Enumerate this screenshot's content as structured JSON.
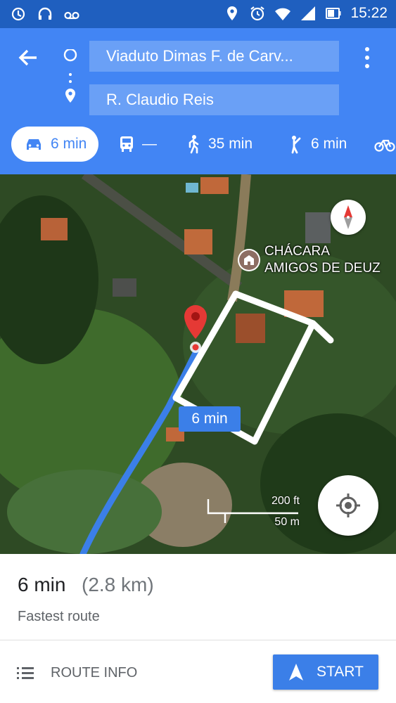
{
  "status_bar": {
    "time": "15:22",
    "icons": [
      "sync-icon",
      "headset-icon",
      "voicemail-icon",
      "location-icon",
      "alarm-icon",
      "wifi-icon",
      "signal-icon",
      "battery-icon"
    ]
  },
  "directions": {
    "origin": "Viaduto Dimas F. de Carv...",
    "destination": "R. Claudio Reis",
    "modes": [
      {
        "name": "car",
        "label": "6 min",
        "selected": true
      },
      {
        "name": "transit",
        "label": "—",
        "selected": false
      },
      {
        "name": "walk",
        "label": "35 min",
        "selected": false
      },
      {
        "name": "ride",
        "label": "6 min",
        "selected": false
      },
      {
        "name": "bike",
        "label": "",
        "selected": false
      }
    ]
  },
  "map": {
    "poi_label_line1": "CHÁCARA",
    "poi_label_line2": "AMIGOS DE DEUZ",
    "route_badge": "6 min",
    "scale_imperial": "200 ft",
    "scale_metric": "50 m",
    "route_color": "#3b7fe8",
    "pin_color": "#e53935"
  },
  "summary": {
    "duration": "6 min",
    "distance": "(2.8 km)",
    "subtitle": "Fastest route",
    "route_info_label": "ROUTE INFO",
    "start_label": "START"
  },
  "colors": {
    "header_blue": "#4285f4",
    "status_blue": "#1f5fbf",
    "field_blue": "#6aa0f6",
    "button_blue": "#3b7fe8"
  }
}
